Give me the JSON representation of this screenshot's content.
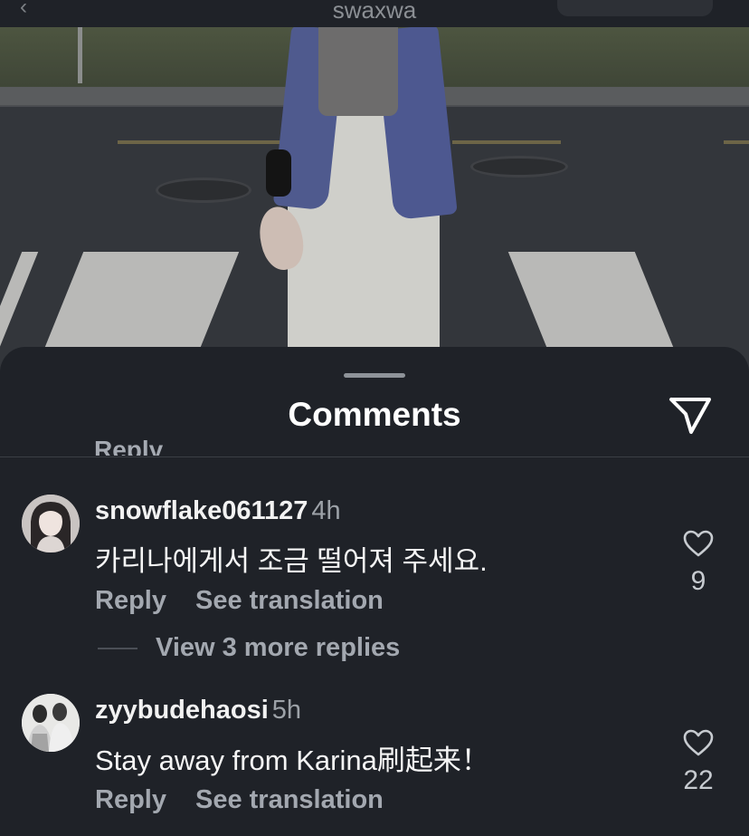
{
  "header": {
    "username": "swaxwa"
  },
  "sheet": {
    "title": "Comments",
    "cut_off_text": "Reply"
  },
  "comments": [
    {
      "username": "snowflake061127",
      "time": "4h",
      "text": "카리나에게서 조금 떨어져 주세요.",
      "reply_label": "Reply",
      "translate_label": "See translation",
      "likes": "9",
      "more_replies": "View 3 more replies"
    },
    {
      "username": "zyybudehaosi",
      "time": "5h",
      "text": "Stay away from Karina刷起来！",
      "reply_label": "Reply",
      "translate_label": "See translation",
      "likes": "22"
    }
  ],
  "icons": {
    "send": "send-icon",
    "heart": "heart-icon",
    "back": "back-arrow-icon"
  },
  "colors": {
    "background": "#1f2228",
    "text_primary": "#ffffff",
    "text_secondary": "#a3a8b0"
  }
}
